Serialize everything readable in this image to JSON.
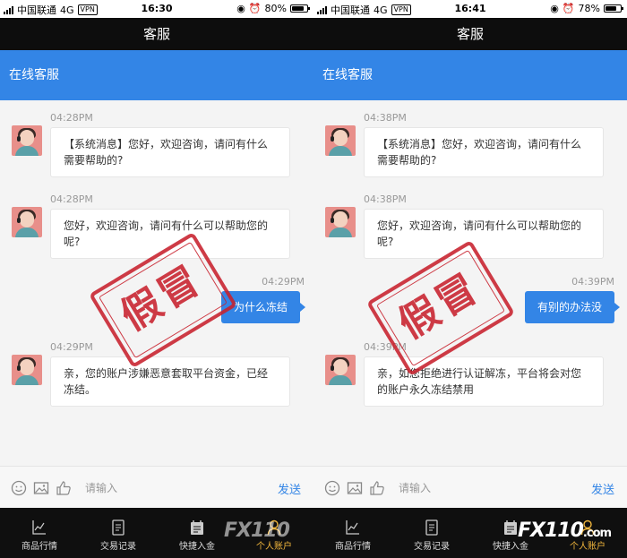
{
  "panels": [
    {
      "status": {
        "carrier": "中国联通",
        "network": "4G",
        "vpn": "VPN",
        "time": "16:30",
        "battery": "80%",
        "battery_level": 0.8
      },
      "title": "客服",
      "section_title": "在线客服",
      "messages": [
        {
          "time": "04:28PM",
          "text": "【系统消息】您好，欢迎咨询，请问有什么需要帮助的?"
        },
        {
          "time": "04:28PM",
          "text": "您好，欢迎咨询，请问有什么可以帮助您的呢?"
        },
        {
          "time": "04:29PM",
          "text": "为什么冻结"
        },
        {
          "time": "04:29PM",
          "text": "亲，您的账户涉嫌恶意套取平台资金，已经冻结。"
        }
      ],
      "stamp": "假冒",
      "input": {
        "placeholder": "请输入",
        "send": "发送"
      },
      "tabs": [
        "商品行情",
        "交易记录",
        "快捷入金",
        "个人账户"
      ],
      "watermark": "FX110"
    },
    {
      "status": {
        "carrier": "中国联通",
        "network": "4G",
        "vpn": "VPN",
        "time": "16:41",
        "battery": "78%",
        "battery_level": 0.78
      },
      "title": "客服",
      "section_title": "在线客服",
      "messages": [
        {
          "time": "04:38PM",
          "text": "【系统消息】您好，欢迎咨询，请问有什么需要帮助的?"
        },
        {
          "time": "04:38PM",
          "text": "您好，欢迎咨询，请问有什么可以帮助您的呢?"
        },
        {
          "time": "04:39PM",
          "text": "有别的办法没"
        },
        {
          "time": "04:39PM",
          "text": "亲，如您拒绝进行认证解冻，平台将会对您的账户永久冻结禁用"
        }
      ],
      "stamp": "假冒",
      "input": {
        "placeholder": "请输入",
        "send": "发送"
      },
      "tabs": [
        "商品行情",
        "交易记录",
        "快捷入金",
        "个人账户"
      ],
      "watermark": "FX110",
      "watermark_suffix": ".com"
    }
  ],
  "colors": {
    "accent": "#3385e6",
    "stamp": "#c8212d",
    "active_tab": "#f0b53c"
  },
  "icons": [
    "signal-icon",
    "alarm-icon",
    "battery-icon",
    "emoji-icon",
    "image-icon",
    "thumbs-up-icon",
    "chart-icon",
    "record-icon",
    "deposit-icon",
    "user-icon"
  ]
}
